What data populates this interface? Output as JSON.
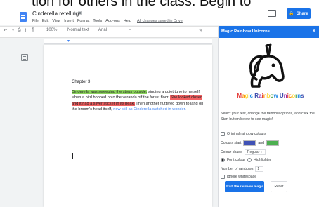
{
  "banner": {
    "text": "tion for others in the class. Begin to"
  },
  "doc": {
    "title": "Cinderella retelling",
    "title_icons": "☆ ▣",
    "menu": [
      "File",
      "Edit",
      "View",
      "Insert",
      "Format",
      "Tools",
      "Add-ons",
      "Help"
    ],
    "saved_status": "All changes saved in Drive"
  },
  "share": {
    "label": "Share",
    "icon": "lock-icon"
  },
  "toolbar": {
    "icons": [
      "↶",
      "↷",
      "⎙",
      "⌇",
      "¶"
    ],
    "zoom": "100%",
    "style": "Normal text",
    "font": "Arial",
    "size": "--",
    "pen": "✎"
  },
  "page": {
    "chapter": "Chapter 3",
    "seg1": "Cinderella was sweeping the steps outside,",
    "seg2": " singing a quiet tune to herself, when a bird hopped onto the veranda off the forest floor. ",
    "seg3": "She looked closer and it had a silver sticker in its beak.",
    "seg4": " Then another fluttered down to land on the broom's head itself, ",
    "seg5": "now still as Cinderella watched in wonder."
  },
  "sidebar": {
    "title": "Magic Rainbow Unicorns",
    "close": "×",
    "heading": "Magic Rainbow Unicorns",
    "description": "Select your text, change the rainbow options, and click the Start button below to see magic!",
    "original_colours": "Original rainbow colours",
    "colours_start": "Colours start",
    "and": "and",
    "colour_start_value": "#3f51b5",
    "colour_end_value": "#4caf50",
    "colour_shade": "Colour shade",
    "shade_value": "Regular ÷",
    "font_colour": "Font colour",
    "highlighter": "Highlighter",
    "num_rainbows_label": "Number of rainbows",
    "num_rainbows": "1",
    "ignore_whitespace": "Ignore whitespace",
    "start_button": "Start the rainbow magic",
    "reset_button": "Reset"
  },
  "colors": {
    "accent": "#1a73e8",
    "doc_blue": "#4285f4"
  }
}
